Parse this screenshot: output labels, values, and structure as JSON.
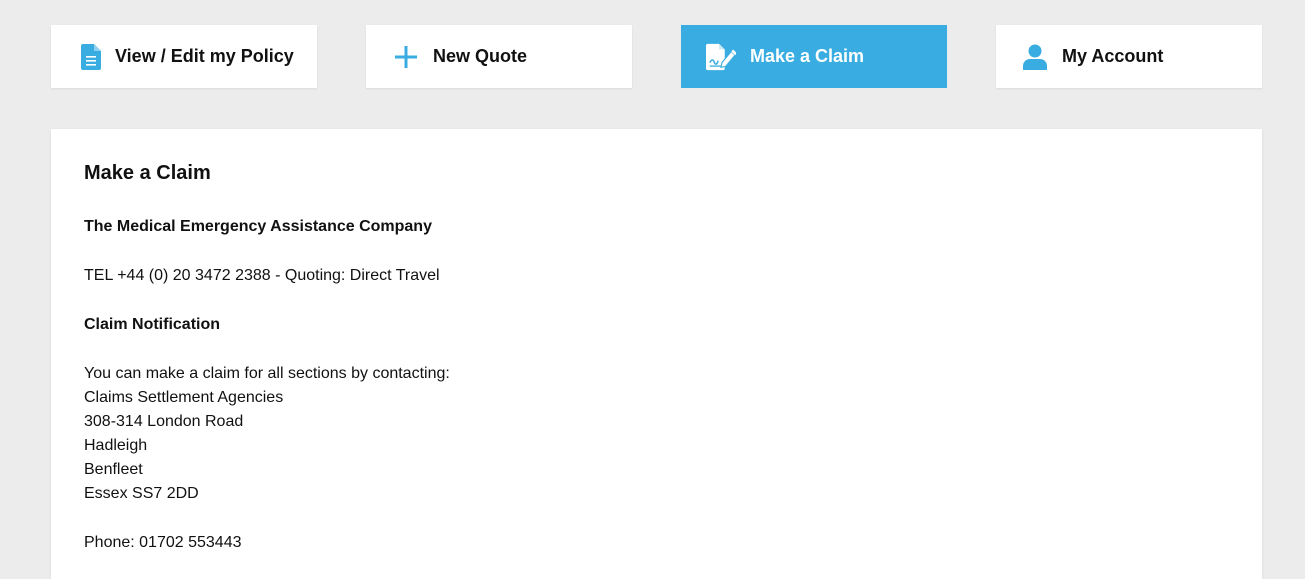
{
  "nav": {
    "items": [
      {
        "label": "View / Edit my Policy",
        "icon": "document-icon"
      },
      {
        "label": "New Quote",
        "icon": "plus-icon"
      },
      {
        "label": "Make a Claim",
        "icon": "claim-form-icon",
        "active": true
      },
      {
        "label": "My Account",
        "icon": "user-icon"
      }
    ]
  },
  "colors": {
    "accent": "#39ade1",
    "page_bg": "#ececec",
    "panel_bg": "#ffffff",
    "text": "#111111"
  },
  "main": {
    "title": "Make a Claim",
    "assistance_company": "The Medical Emergency Assistance Company",
    "tel_line": "TEL +44 (0) 20 3472 2388 - Quoting: Direct Travel",
    "claim_heading": "Claim Notification",
    "claim_intro": "You can make a claim for all sections by contacting:",
    "address": {
      "line1": "Claims Settlement Agencies",
      "line2": "308-314 London Road",
      "line3": "Hadleigh",
      "line4": "Benfleet",
      "line5": "Essex SS7 2DD"
    },
    "phone_line": "Phone: 01702 553443"
  }
}
